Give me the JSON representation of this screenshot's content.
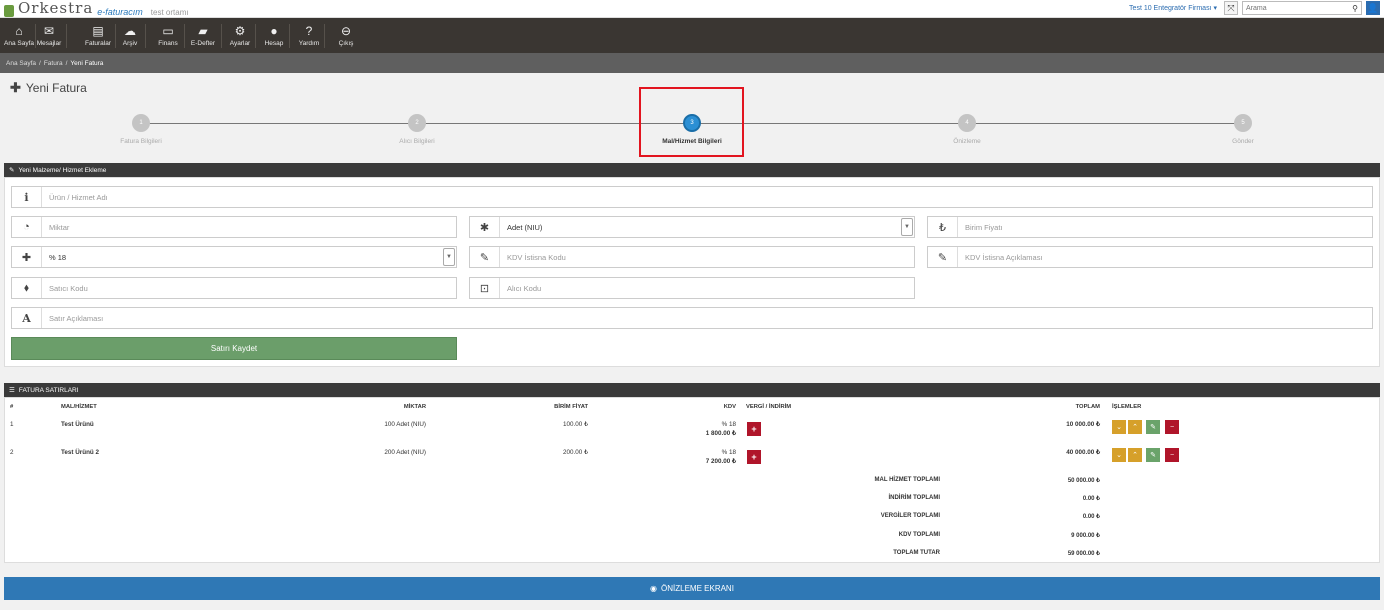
{
  "header": {
    "logo_text": "Orkestra",
    "logo_sub": "e-faturacım",
    "env_label": "test ortamı",
    "company": "Test 10 Entegratör Firması",
    "search_placeholder": "Arama"
  },
  "nav": [
    {
      "label": "Ana Sayfa",
      "icon": "home-icon",
      "glyph": "⌂"
    },
    {
      "label": "Mesajlar",
      "icon": "comments-icon",
      "glyph": "✉"
    },
    {
      "label": "Faturalar",
      "icon": "invoice-icon",
      "glyph": "▤"
    },
    {
      "label": "Arşiv",
      "icon": "cloud-icon",
      "glyph": "☁"
    },
    {
      "label": "Finans",
      "icon": "card-icon",
      "glyph": "▭"
    },
    {
      "label": "E-Defter",
      "icon": "book-icon",
      "glyph": "▰"
    },
    {
      "label": "Ayarlar",
      "icon": "cogs-icon",
      "glyph": "⚙"
    },
    {
      "label": "Hesap",
      "icon": "user-icon",
      "glyph": "●"
    },
    {
      "label": "Yardım",
      "icon": "question-icon",
      "glyph": "?"
    },
    {
      "label": "Çıkış",
      "icon": "exit-icon",
      "glyph": "⊖"
    }
  ],
  "breadcrumb": [
    "Ana Sayfa",
    "Fatura",
    "Yeni Fatura"
  ],
  "page_title": "Yeni Fatura",
  "wizard": [
    {
      "num": "1",
      "label": "Fatura Bilgileri"
    },
    {
      "num": "2",
      "label": "Alıcı Bilgileri"
    },
    {
      "num": "3",
      "label": "Mal/Hizmet Bilgileri"
    },
    {
      "num": "4",
      "label": "Önizleme"
    },
    {
      "num": "5",
      "label": "Gönder"
    }
  ],
  "form": {
    "title": "Yeni Malzeme/ Hizmet Ekleme",
    "product_placeholder": "Ürün / Hizmet Adı",
    "quantity_placeholder": "Miktar",
    "unit_value": "Adet (NIU)",
    "unit_price_placeholder": "Birim Fiyatı",
    "vat_value": "% 18",
    "vat_exemption_code_placeholder": "KDV İstisna Kodu",
    "vat_exemption_desc_placeholder": "KDV İstisna Açıklaması",
    "seller_code_placeholder": "Satıcı Kodu",
    "buyer_code_placeholder": "Alıcı Kodu",
    "line_desc_placeholder": "Satır Açıklaması",
    "save_label": "Satırı Kaydet"
  },
  "lines": {
    "title": "FATURA SATIRLARI",
    "headers": {
      "num": "#",
      "item": "MAL/HİZMET",
      "qty": "MİKTAR",
      "price": "BİRİM FİYAT",
      "kdv": "KDV",
      "tax": "VERGİ / İNDİRİM",
      "total": "TOPLAM",
      "actions": "İŞLEMLER"
    },
    "rows": [
      {
        "num": "1",
        "item": "Test Ürünü",
        "qty": "100 Adet (NIU)",
        "price": "100.00 ₺",
        "kdv_rate": "% 18",
        "kdv_amount": "1 800.00 ₺",
        "total": "10 000.00 ₺"
      },
      {
        "num": "2",
        "item": "Test Ürünü 2",
        "qty": "200 Adet (NIU)",
        "price": "200.00 ₺",
        "kdv_rate": "% 18",
        "kdv_amount": "7 200.00 ₺",
        "total": "40 000.00 ₺"
      }
    ],
    "summary": [
      {
        "label": "MAL HİZMET TOPLAMI",
        "value": "50 000.00 ₺"
      },
      {
        "label": "İNDİRİM TOPLAMI",
        "value": "0.00 ₺"
      },
      {
        "label": "VERGİLER TOPLAMI",
        "value": "0.00 ₺"
      },
      {
        "label": "KDV TOPLAMI",
        "value": "9 000.00 ₺"
      },
      {
        "label": "TOPLAM TUTAR",
        "value": "59 000.00 ₺"
      }
    ]
  },
  "preview_label": "ÖNİZLEME EKRANI",
  "colors": {
    "accent": "#2f78b5",
    "highlight": "#e2141f",
    "nav_bg": "#3a3632",
    "save_green": "#6b9e6a",
    "danger": "#b0152a",
    "warning": "#d6a02a"
  }
}
